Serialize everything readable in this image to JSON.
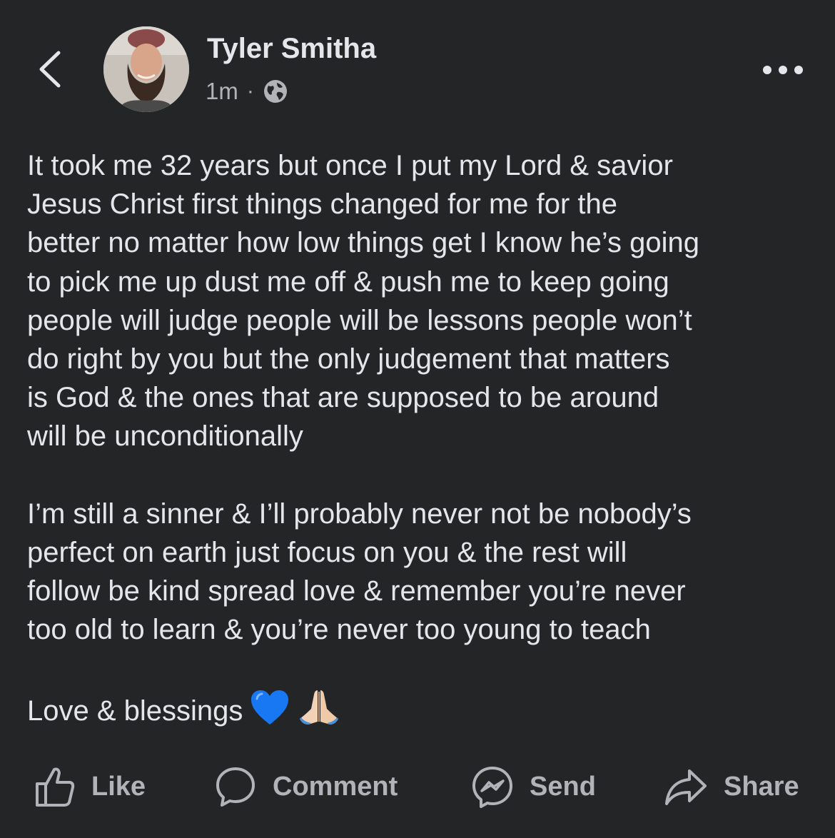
{
  "post": {
    "author": "Tyler Smitha",
    "time": "1m",
    "separator": "·",
    "privacy_icon": "globe-icon",
    "paragraphs": [
      "It took me 32 years but once I put my Lord & savior\nJesus Christ first things changed for me for the\nbetter no matter how low things get I know he’s going\nto pick me up dust me off & push me to keep going\npeople will judge people will be lessons people won’t\ndo right by you but the only judgement that matters\nis God & the ones that are supposed to be around\nwill be unconditionally",
      "I’m still a sinner & I’ll probably never not be nobody’s\nperfect on earth just focus on you & the rest will\nfollow be kind spread love & remember you’re never\ntoo old to learn & you’re never too young to teach"
    ],
    "closing": "Love & blessings",
    "closing_emojis": [
      "blue-heart-icon",
      "praying-hands-icon"
    ]
  },
  "actions": {
    "like": "Like",
    "comment": "Comment",
    "send": "Send",
    "share": "Share"
  },
  "colors": {
    "background": "#242526",
    "primary_text": "#e4e6eb",
    "secondary_text": "#b0b3b8",
    "heart": "#1877f2"
  }
}
